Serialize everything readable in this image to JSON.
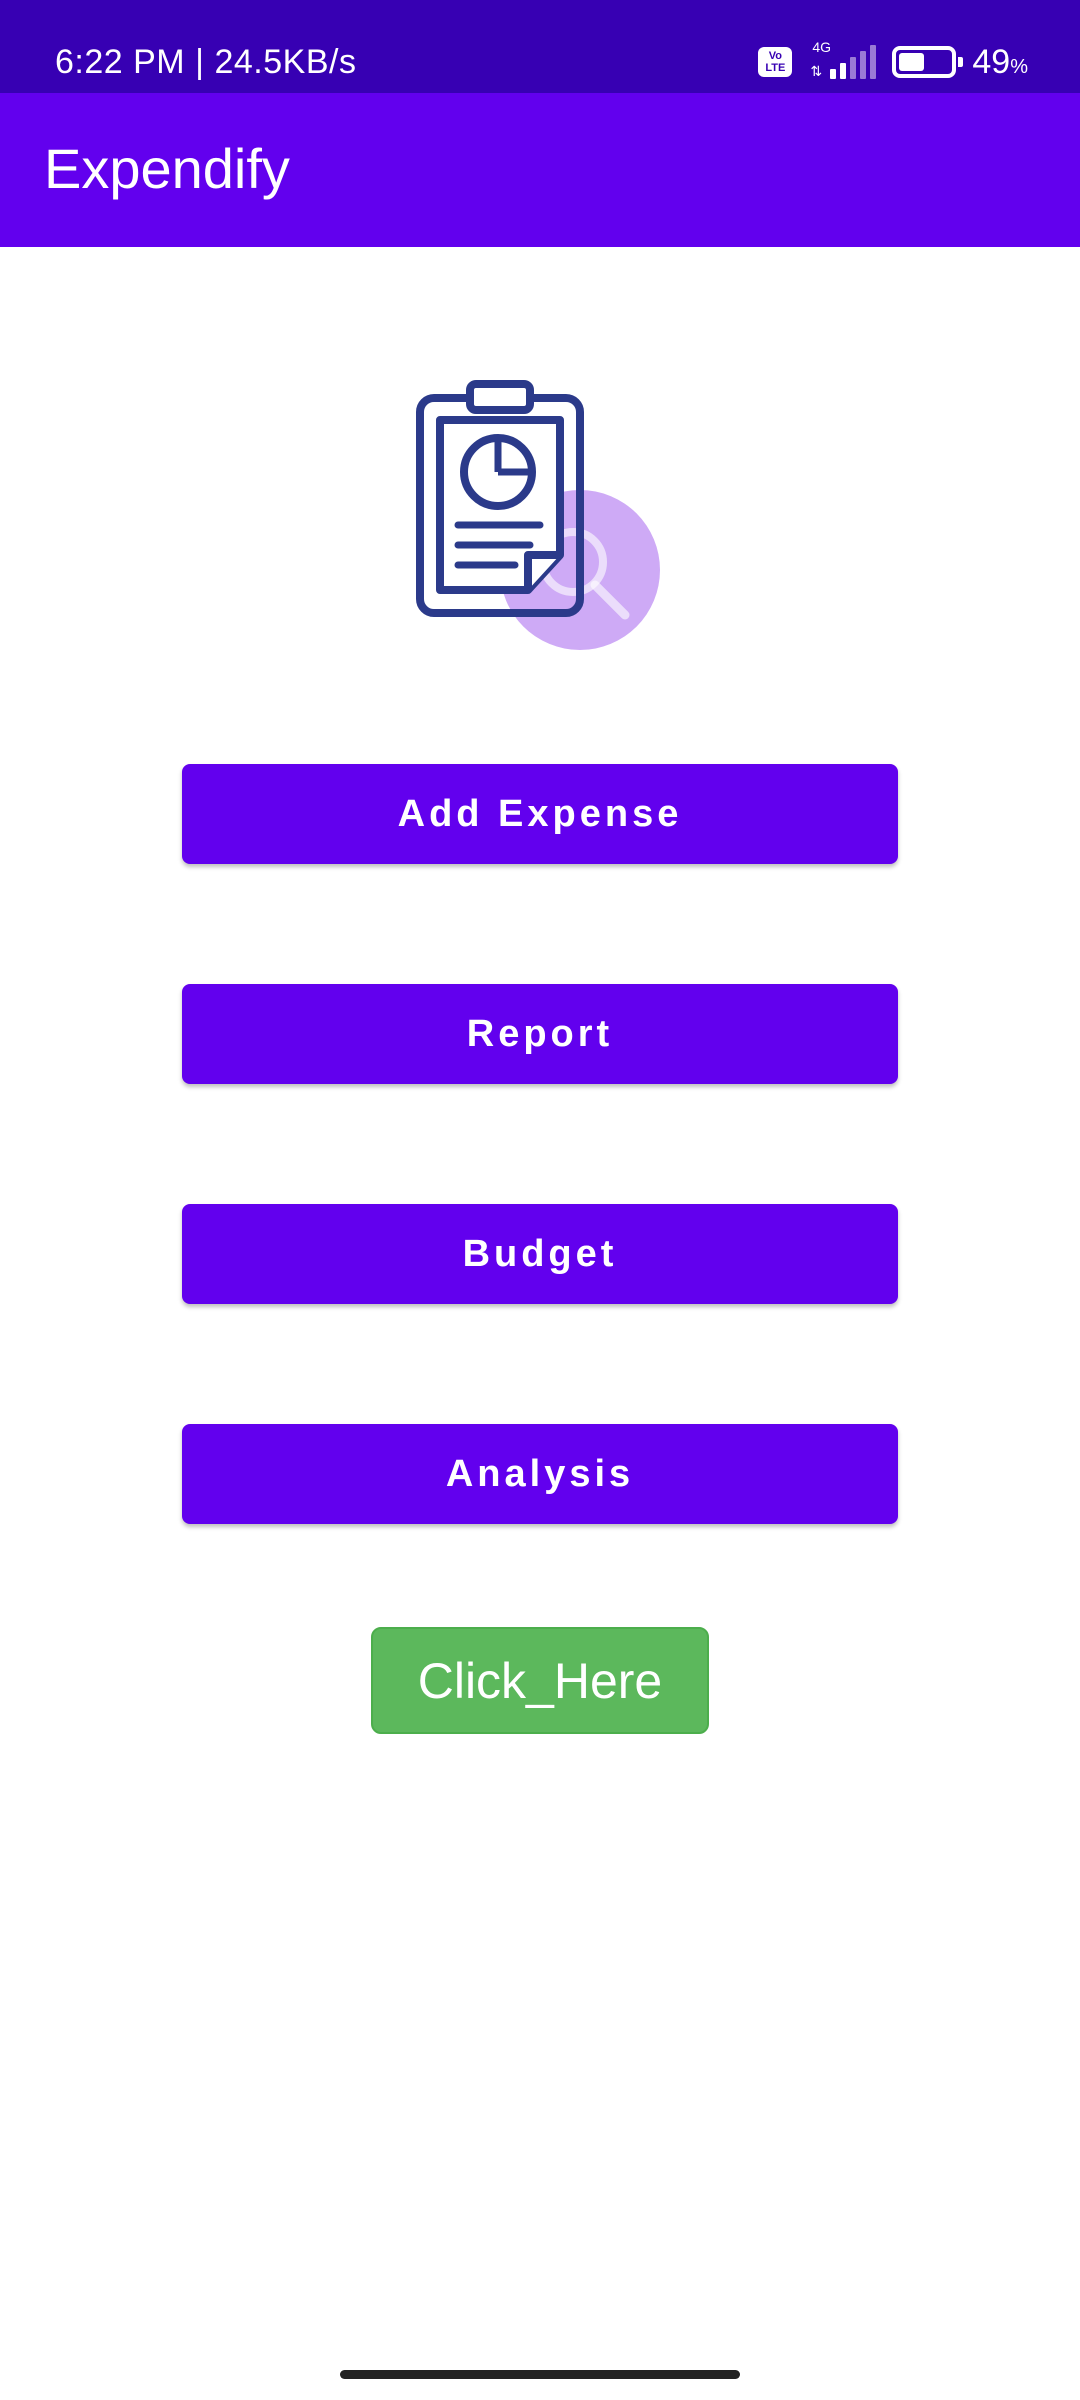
{
  "status_bar": {
    "time": "6:22 PM",
    "separator": "|",
    "network_speed": "24.5KB/s",
    "volte_label": "Vo LTE",
    "network_type": "4G",
    "battery_level": 49,
    "battery_text": "49",
    "battery_unit": "%"
  },
  "app_bar": {
    "title": "Expendify"
  },
  "illustration": {
    "icon": "clipboard-report-search-icon",
    "primary_color": "#2B3A8A",
    "accent_color": "#C69BF5"
  },
  "buttons": {
    "add_expense": "Add Expense",
    "report": "Report",
    "budget": "Budget",
    "analysis": "Analysis",
    "click_here": "Click_Here"
  },
  "colors": {
    "status_bar": "#3700B3",
    "primary": "#6200EE",
    "success": "#5CB85C"
  }
}
